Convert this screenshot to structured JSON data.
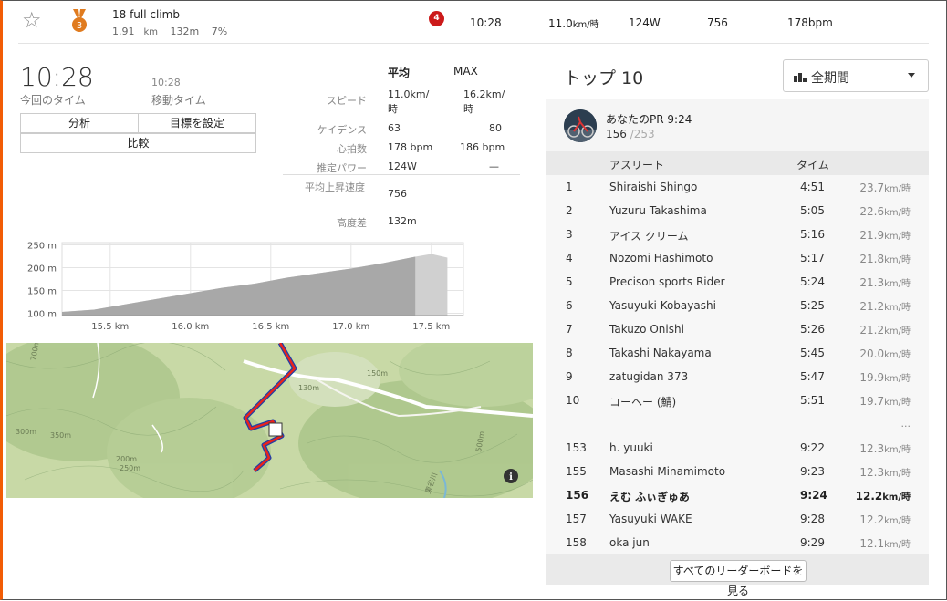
{
  "segment": {
    "name": "18 full climb",
    "distance": "1.91",
    "distance_unit": "km",
    "elev": "132m",
    "grade": "7%",
    "rank_badge": "4",
    "time": "10:28",
    "speed": "11.0",
    "speed_unit": "km/時",
    "power": "124W",
    "vam": "756",
    "hr": "178bpm",
    "medal_number": "3"
  },
  "effort": {
    "time": "10:28",
    "time_label": "今回のタイム",
    "moving_time": "10:28",
    "moving_time_label": "移動タイム",
    "buttons": {
      "analysis": "分析",
      "set_goal": "目標を設定",
      "compare": "比較"
    }
  },
  "stats": {
    "avg_header": "平均",
    "max_header": "MAX",
    "rows": [
      {
        "label": "スピード",
        "avg": "11.0km/時",
        "max": "16.2km/時"
      },
      {
        "label": "ケイデンス",
        "avg": "63",
        "max": "80"
      },
      {
        "label": "心拍数",
        "avg": "178 bpm",
        "max": "186 bpm"
      },
      {
        "label": "推定パワー",
        "avg": "124W",
        "max": "—"
      },
      {
        "label": "平均上昇速度",
        "avg": "756",
        "max": ""
      },
      {
        "label": "高度差",
        "avg": "132m",
        "max": ""
      }
    ]
  },
  "chart_data": {
    "type": "area",
    "x": [
      15.2,
      15.4,
      15.6,
      15.8,
      16.0,
      16.2,
      16.4,
      16.6,
      16.8,
      17.0,
      17.2,
      17.4,
      17.5,
      17.6
    ],
    "y": [
      103,
      108,
      120,
      132,
      144,
      156,
      165,
      178,
      188,
      198,
      210,
      224,
      230,
      222
    ],
    "xticks": [
      "15.5 km",
      "16.0 km",
      "16.5 km",
      "17.0 km",
      "17.5 km"
    ],
    "xtick_values": [
      15.5,
      16.0,
      16.5,
      17.0,
      17.5
    ],
    "yticks": [
      "250 m",
      "200 m",
      "150 m",
      "100 m"
    ],
    "ytick_values": [
      250,
      200,
      150,
      100
    ],
    "xlim": [
      15.2,
      17.7
    ],
    "ylim": [
      95,
      255
    ],
    "highlight_range": [
      15.2,
      17.4
    ],
    "grid": true
  },
  "map": {
    "labels": [
      "700m",
      "150m",
      "130m",
      "300m",
      "350m",
      "200m",
      "250m",
      "500m",
      "東谷川"
    ],
    "info_icon": "info-icon"
  },
  "leaderboard": {
    "title": "トップ 10",
    "filter": "全期間",
    "pr_label": "あなたのPR 9:24",
    "pr_rank": "156",
    "pr_total": "/253",
    "col_athlete": "アスリート",
    "col_time": "タイム",
    "ellipsis": "...",
    "rows": [
      {
        "rank": "1",
        "name": "Shiraishi Shingo",
        "time": "4:51",
        "speed": "23.7",
        "unit": "km/時"
      },
      {
        "rank": "2",
        "name": "Yuzuru Takashima",
        "time": "5:05",
        "speed": "22.6",
        "unit": "km/時"
      },
      {
        "rank": "3",
        "name": "アイス クリーム",
        "time": "5:16",
        "speed": "21.9",
        "unit": "km/時"
      },
      {
        "rank": "4",
        "name": "Nozomi Hashimoto",
        "time": "5:17",
        "speed": "21.8",
        "unit": "km/時"
      },
      {
        "rank": "5",
        "name": "Precison sports Rider",
        "time": "5:24",
        "speed": "21.3",
        "unit": "km/時"
      },
      {
        "rank": "6",
        "name": "Yasuyuki Kobayashi",
        "time": "5:25",
        "speed": "21.2",
        "unit": "km/時"
      },
      {
        "rank": "7",
        "name": "Takuzo Onishi",
        "time": "5:26",
        "speed": "21.2",
        "unit": "km/時"
      },
      {
        "rank": "8",
        "name": "Takashi Nakayama",
        "time": "5:45",
        "speed": "20.0",
        "unit": "km/時"
      },
      {
        "rank": "9",
        "name": "zatugidan 373",
        "time": "5:47",
        "speed": "19.9",
        "unit": "km/時"
      },
      {
        "rank": "10",
        "name": "コーヘー (鯖)",
        "time": "5:51",
        "speed": "19.7",
        "unit": "km/時"
      }
    ],
    "nearby": [
      {
        "rank": "153",
        "name": "h. yuuki",
        "time": "9:22",
        "speed": "12.3",
        "unit": "km/時"
      },
      {
        "rank": "155",
        "name": "Masashi Minamimoto",
        "time": "9:23",
        "speed": "12.3",
        "unit": "km/時"
      },
      {
        "rank": "156",
        "name": "えむ ふぃぎゅあ",
        "time": "9:24",
        "speed": "12.2",
        "unit": "km/時",
        "me": true
      },
      {
        "rank": "157",
        "name": "Yasuyuki WAKE",
        "time": "9:28",
        "speed": "12.2",
        "unit": "km/時"
      },
      {
        "rank": "158",
        "name": "oka jun",
        "time": "9:29",
        "speed": "12.1",
        "unit": "km/時"
      }
    ],
    "see_all": "すべてのリーダーボードを見る"
  },
  "colors": {
    "accent": "#f25c05",
    "badge": "#cc1a1a",
    "route_red": "#e8231c",
    "route_blue": "#1f3fa8",
    "bronze": "#e07b1f"
  }
}
